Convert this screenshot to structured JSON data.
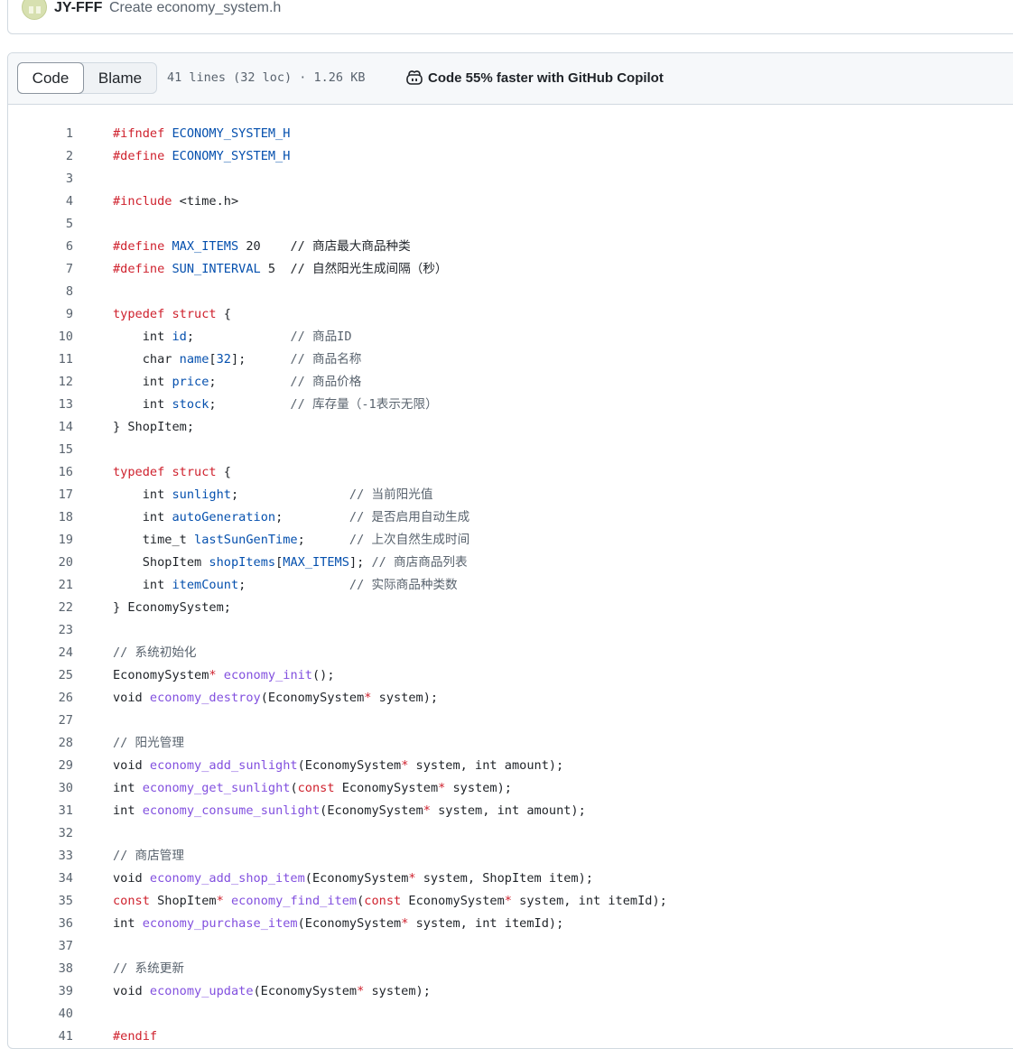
{
  "commit": {
    "author": "JY-FFF",
    "message": "Create economy_system.h"
  },
  "file_header": {
    "tabs": [
      "Code",
      "Blame"
    ],
    "active_tab": "Code",
    "meta": "41 lines (32 loc) · 1.26 KB",
    "copilot_label": "Code 55% faster with GitHub Copilot"
  },
  "colors": {
    "keyword": "#cf222e",
    "constant": "#0550ae",
    "function": "#8250df",
    "comment": "#59636e",
    "text": "#1f2328"
  },
  "code_lines": [
    [
      [
        "k",
        "#ifndef "
      ],
      [
        "c",
        "ECONOMY_SYSTEM_H"
      ]
    ],
    [
      [
        "k",
        "#define "
      ],
      [
        "c",
        "ECONOMY_SYSTEM_H"
      ]
    ],
    [],
    [
      [
        "k",
        "#include "
      ],
      [
        "",
        "<time.h>"
      ]
    ],
    [],
    [
      [
        "k",
        "#define "
      ],
      [
        "c",
        "MAX_ITEMS"
      ],
      [
        "",
        " 20    // 商店最大商品种类"
      ]
    ],
    [
      [
        "k",
        "#define "
      ],
      [
        "c",
        "SUN_INTERVAL"
      ],
      [
        "",
        " 5  // 自然阳光生成间隔（秒）"
      ]
    ],
    [],
    [
      [
        "k",
        "typedef "
      ],
      [
        "k",
        "struct"
      ],
      [
        "",
        " {"
      ]
    ],
    [
      [
        "",
        "    int "
      ],
      [
        "c",
        "id"
      ],
      [
        "",
        ";"
      ],
      [
        "m",
        "             // 商品ID"
      ]
    ],
    [
      [
        "",
        "    char "
      ],
      [
        "c",
        "name"
      ],
      [
        "",
        "["
      ],
      [
        "c",
        "32"
      ],
      [
        "",
        "];"
      ],
      [
        "m",
        "      // 商品名称"
      ]
    ],
    [
      [
        "",
        "    int "
      ],
      [
        "c",
        "price"
      ],
      [
        "",
        ";"
      ],
      [
        "m",
        "          // 商品价格"
      ]
    ],
    [
      [
        "",
        "    int "
      ],
      [
        "c",
        "stock"
      ],
      [
        "",
        ";"
      ],
      [
        "m",
        "          // 库存量（-1表示无限）"
      ]
    ],
    [
      [
        "",
        "} ShopItem;"
      ]
    ],
    [],
    [
      [
        "k",
        "typedef "
      ],
      [
        "k",
        "struct"
      ],
      [
        "",
        " {"
      ]
    ],
    [
      [
        "",
        "    int "
      ],
      [
        "c",
        "sunlight"
      ],
      [
        "",
        ";"
      ],
      [
        "m",
        "               // 当前阳光值"
      ]
    ],
    [
      [
        "",
        "    int "
      ],
      [
        "c",
        "autoGeneration"
      ],
      [
        "",
        ";"
      ],
      [
        "m",
        "         // 是否启用自动生成"
      ]
    ],
    [
      [
        "",
        "    time_t "
      ],
      [
        "c",
        "lastSunGenTime"
      ],
      [
        "",
        ";"
      ],
      [
        "m",
        "      // 上次自然生成时间"
      ]
    ],
    [
      [
        "",
        "    ShopItem "
      ],
      [
        "c",
        "shopItems"
      ],
      [
        "",
        "["
      ],
      [
        "c",
        "MAX_ITEMS"
      ],
      [
        "",
        "];"
      ],
      [
        "m",
        " // 商店商品列表"
      ]
    ],
    [
      [
        "",
        "    int "
      ],
      [
        "c",
        "itemCount"
      ],
      [
        "",
        ";"
      ],
      [
        "m",
        "              // 实际商品种类数"
      ]
    ],
    [
      [
        "",
        "} EconomySystem;"
      ]
    ],
    [],
    [
      [
        "m",
        "// 系统初始化"
      ]
    ],
    [
      [
        "",
        "EconomySystem"
      ],
      [
        "k",
        "*"
      ],
      [
        "",
        " "
      ],
      [
        "f",
        "economy_init"
      ],
      [
        "",
        "();"
      ]
    ],
    [
      [
        "",
        "void "
      ],
      [
        "f",
        "economy_destroy"
      ],
      [
        "",
        "(EconomySystem"
      ],
      [
        "k",
        "*"
      ],
      [
        "",
        " system);"
      ]
    ],
    [],
    [
      [
        "m",
        "// 阳光管理"
      ]
    ],
    [
      [
        "",
        "void "
      ],
      [
        "f",
        "economy_add_sunlight"
      ],
      [
        "",
        "(EconomySystem"
      ],
      [
        "k",
        "*"
      ],
      [
        "",
        " system, int amount);"
      ]
    ],
    [
      [
        "",
        "int "
      ],
      [
        "f",
        "economy_get_sunlight"
      ],
      [
        "",
        "("
      ],
      [
        "k",
        "const"
      ],
      [
        "",
        " EconomySystem"
      ],
      [
        "k",
        "*"
      ],
      [
        "",
        " system);"
      ]
    ],
    [
      [
        "",
        "int "
      ],
      [
        "f",
        "economy_consume_sunlight"
      ],
      [
        "",
        "(EconomySystem"
      ],
      [
        "k",
        "*"
      ],
      [
        "",
        " system, int amount);"
      ]
    ],
    [],
    [
      [
        "m",
        "// 商店管理"
      ]
    ],
    [
      [
        "",
        "void "
      ],
      [
        "f",
        "economy_add_shop_item"
      ],
      [
        "",
        "(EconomySystem"
      ],
      [
        "k",
        "*"
      ],
      [
        "",
        " system, ShopItem item);"
      ]
    ],
    [
      [
        "k",
        "const"
      ],
      [
        "",
        " ShopItem"
      ],
      [
        "k",
        "*"
      ],
      [
        "",
        " "
      ],
      [
        "f",
        "economy_find_item"
      ],
      [
        "",
        "("
      ],
      [
        "k",
        "const"
      ],
      [
        "",
        " EconomySystem"
      ],
      [
        "k",
        "*"
      ],
      [
        "",
        " system, int itemId);"
      ]
    ],
    [
      [
        "",
        "int "
      ],
      [
        "f",
        "economy_purchase_item"
      ],
      [
        "",
        "(EconomySystem"
      ],
      [
        "k",
        "*"
      ],
      [
        "",
        " system, int itemId);"
      ]
    ],
    [],
    [
      [
        "m",
        "// 系统更新"
      ]
    ],
    [
      [
        "",
        "void "
      ],
      [
        "f",
        "economy_update"
      ],
      [
        "",
        "(EconomySystem"
      ],
      [
        "k",
        "*"
      ],
      [
        "",
        " system);"
      ]
    ],
    [],
    [
      [
        "k",
        "#endif"
      ]
    ]
  ]
}
